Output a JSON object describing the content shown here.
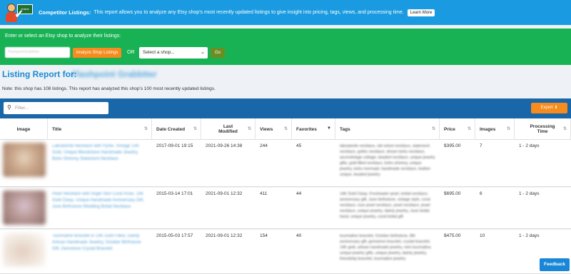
{
  "banner": {
    "logo_text": "Online",
    "title": "Competitor Listings:",
    "description": "This report allows you to analyze any Etsy shop's most recently updated listings to give insight into pricing, tags, views, and processing time.",
    "learn_more": "Learn More"
  },
  "shop_form": {
    "prompt": "Enter or select an Etsy shop to analyze their listings:",
    "input_value": "FlashpointGrabbtter",
    "analyze_label": "Analyze Shop Listings",
    "or_label": "OR",
    "select_value": "Select a shop...",
    "go_label": "Go"
  },
  "report": {
    "title": "Listing Report for:",
    "shop_name": "Flashpoint Grabbtter",
    "note": "Note: this shop has 108 listings. This report has analyzed this shop's 100 most recently updated listings."
  },
  "table_bar": {
    "filter_placeholder": "Filter...",
    "export_label": "Export"
  },
  "columns": {
    "image": "Image",
    "title": "Title",
    "date_created": "Date Created",
    "last_modified": "Last Modified",
    "views": "Views",
    "favorites": "Favorites",
    "tags": "Tags",
    "price": "Price",
    "images": "Images",
    "processing_time": "Processing Time"
  },
  "rows": [
    {
      "thumb_color": "#c9a68a",
      "title": "Labradorite Necklace with Pyrite, Vintage 14K Gold, Unique Bloodstone Handmade Jewelry, Boho Shimmy Statement Necklace",
      "date_created": "2017-09-01 19:15",
      "last_modified": "2021-09-26 14:38",
      "views": "244",
      "favorites": "45",
      "tags": "labradorite necklace, old velvet necklace, statement necklace, gothic necklace, dream boho necklace, ascendnlage cottage, beaded necklace, unique jewelry gifts, gold filled necklace, boho shimmy, unique jewelry, boho mermaid, handmade necklace, leather unique, beaded jewelry",
      "price": "$395.00",
      "images": "7",
      "processing": "1 - 2 days"
    },
    {
      "thumb_color": "#b89896",
      "title": "Pearl Necklace with Angel Skin Coral Rose, 14K Gold Clasp, Unique Handmade Anniversary Gift, June Birthstone Wedding Bridal Necklace",
      "date_created": "2015-03-14 17:01",
      "last_modified": "2021-09-01 12:32",
      "views": "411",
      "favorites": "44",
      "tags": "14K Gold Clasp, Freshwater pearl, bridal necklace, anniversary gift, June birthstone, vintage style, coral necklace, rose pearl necklace, pearl necklace, jewel necklace, unique jewelry, dainty jewelry, June bridal hand, unique jewelry, coral bridal gift",
      "price": "$695.00",
      "images": "6",
      "processing": "1 - 2 days"
    },
    {
      "thumb_color": "#d8c2b0",
      "title": "Tourmaline Bracelet in 14K Gold Filled, Dainty Artisan Handmade Jewelry, October Birthstone Gift, Gemstone Crystal Bracelet",
      "date_created": "2015-05-03 17:57",
      "last_modified": "2021-09-01 12:32",
      "views": "154",
      "favorites": "40",
      "tags": "tourmaline bracelet, October birthstone, 8th anniversary gift, gemstone bracelet, crystal bracelet, 14K gold, artisan handmade jewelry, mini tourmaline, unique jewelry gifts, unique jewelry, dainty jewelry, friendship bracelet, tourmaline jewelry",
      "price": "$475.00",
      "images": "10",
      "processing": "1 - 2 days"
    }
  ],
  "feedback_label": "Feedback"
}
